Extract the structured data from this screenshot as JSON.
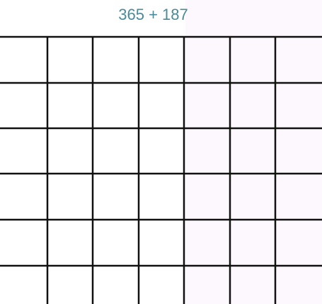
{
  "problem": {
    "expression": "365 + 187"
  },
  "grid": {
    "rows": 6,
    "columns": 7,
    "line_color": "#111111",
    "text_color": "#4a8a9a",
    "right_side_tint": "#fdf8fd"
  }
}
